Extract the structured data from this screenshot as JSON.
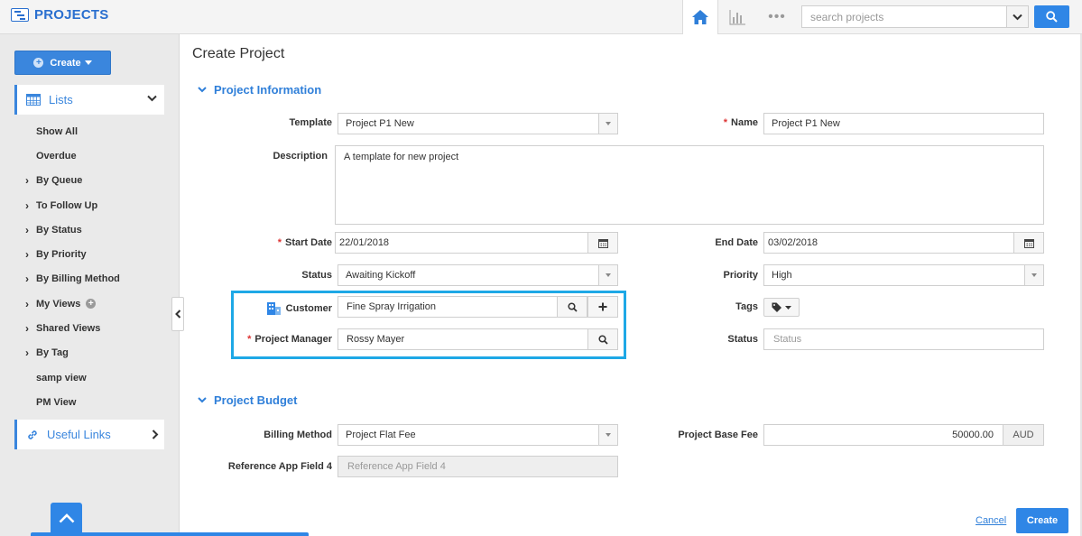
{
  "app": {
    "title": "PROJECTS"
  },
  "topbar": {
    "search_placeholder": "search projects"
  },
  "sidebar": {
    "create_label": "Create",
    "lists_label": "Lists",
    "useful_links_label": "Useful Links",
    "items": [
      {
        "label": "Show All",
        "expandable": false
      },
      {
        "label": "Overdue",
        "expandable": false
      },
      {
        "label": "By Queue",
        "expandable": true
      },
      {
        "label": "To Follow Up",
        "expandable": true
      },
      {
        "label": "By Status",
        "expandable": true
      },
      {
        "label": "By Priority",
        "expandable": true
      },
      {
        "label": "By Billing Method",
        "expandable": true
      },
      {
        "label": "My Views",
        "expandable": true
      },
      {
        "label": "Shared Views",
        "expandable": true
      },
      {
        "label": "By Tag",
        "expandable": true
      },
      {
        "label": "samp view",
        "expandable": false
      },
      {
        "label": "PM View",
        "expandable": false
      }
    ]
  },
  "form": {
    "page_title": "Create Project",
    "section_info": "Project Information",
    "section_budget": "Project Budget",
    "labels": {
      "template": "Template",
      "name": "Name",
      "description": "Description",
      "start_date": "Start Date",
      "end_date": "End Date",
      "status": "Status",
      "priority": "Priority",
      "customer": "Customer",
      "tags": "Tags",
      "project_manager": "Project Manager",
      "status2": "Status",
      "billing_method": "Billing Method",
      "project_base_fee": "Project Base Fee",
      "reference_app_field": "Reference App Field 4"
    },
    "values": {
      "template": "Project P1 New",
      "name": "Project P1 New",
      "description": "A template for new project",
      "start_date": "22/01/2018",
      "end_date": "03/02/2018",
      "status": "Awaiting Kickoff",
      "priority": "High",
      "customer": "Fine Spray Irrigation",
      "project_manager": "Rossy Mayer",
      "billing_method": "Project Flat Fee",
      "project_base_fee": "50000.00",
      "currency": "AUD"
    },
    "placeholders": {
      "status2": "Status",
      "reference_app_field": "Reference App Field 4"
    },
    "actions": {
      "cancel": "Cancel",
      "create": "Create"
    }
  },
  "colors": {
    "accent": "#2f86e6",
    "highlight": "#1ea8e6",
    "required": "#dd3333"
  }
}
